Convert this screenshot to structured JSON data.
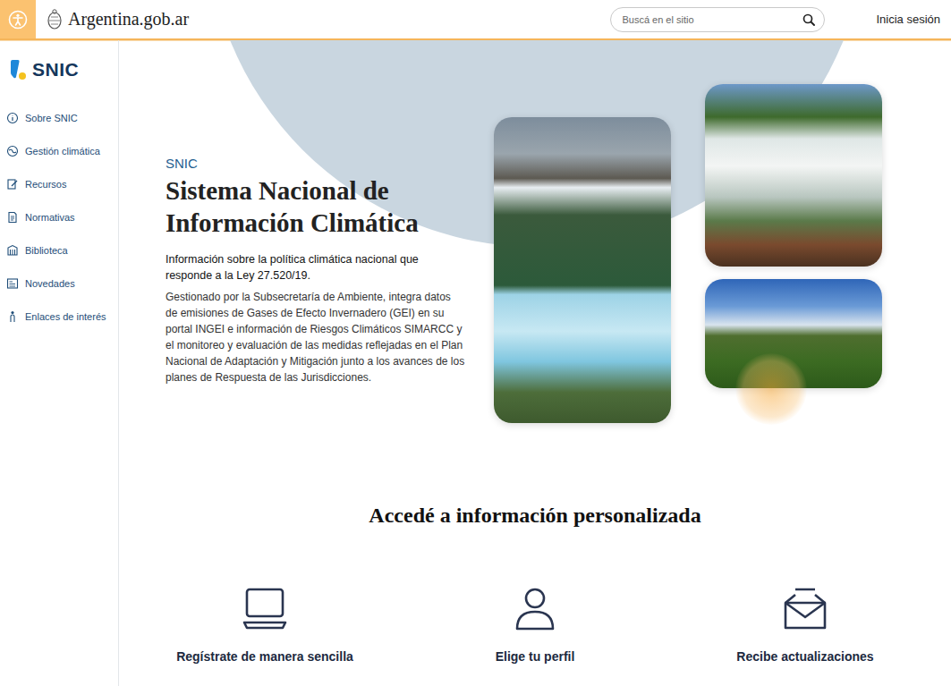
{
  "header": {
    "logo": "Argentina.gob.ar",
    "search": {
      "placeholder": "Buscá en el sitio"
    },
    "login": "Inicia sesión"
  },
  "sidebar": {
    "logo": "SNIC",
    "items": [
      {
        "label": "Sobre SNIC"
      },
      {
        "label": "Gestión climática"
      },
      {
        "label": "Recursos"
      },
      {
        "label": "Normativas"
      },
      {
        "label": "Biblioteca"
      },
      {
        "label": "Novedades"
      },
      {
        "label": "Enlaces de interés"
      }
    ]
  },
  "hero": {
    "eyebrow": "SNIC",
    "title": "Sistema Nacional de Información Climática",
    "lead": "Información sobre la política climática nacional que responde a la Ley 27.520/19.",
    "body": "Gestionado por la Subsecretaría de Ambiente, integra datos de emisiones de Gases de Efecto Invernadero (GEI) en su portal INGEI e información de Riesgos Climáticos SIMARCC y el monitoreo y evaluación de las medidas reflejadas en el Plan Nacional de Adaptación y Mitigación junto a los avances de los planes de Respuesta de las Jurisdicciones."
  },
  "section": {
    "title": "Accedé a información personalizada",
    "features": [
      {
        "label": "Regístrate de manera sencilla"
      },
      {
        "label": "Elige tu perfil"
      },
      {
        "label": "Recibe actualizaciones"
      }
    ]
  }
}
